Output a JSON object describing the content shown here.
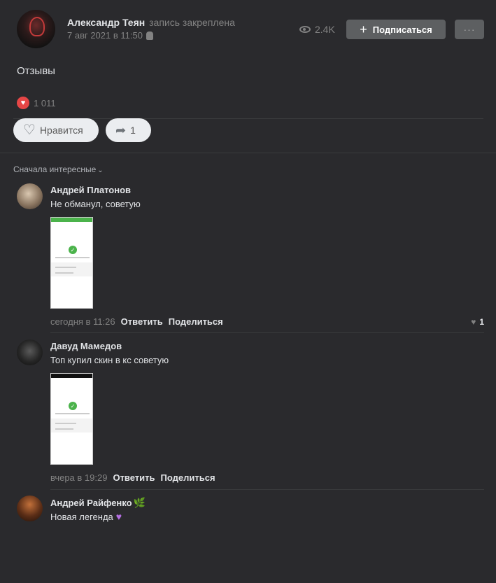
{
  "post": {
    "author": "Александр Теян",
    "pinned_label": "запись закреплена",
    "date": "7 авг 2021 в 11:50",
    "views": "2.4K",
    "subscribe_label": "Подписаться",
    "more_label": "···",
    "text": "Отзывы",
    "likes_count": "1 011",
    "like_label": "Нравится",
    "share_count": "1"
  },
  "comments_sort": {
    "label": "Сначала интересные"
  },
  "comments": [
    {
      "author": "Андрей Платонов",
      "text": "Не обманул, советую",
      "time": "сегодня в 11:26",
      "reply": "Ответить",
      "share": "Поделиться",
      "likes": "1"
    },
    {
      "author": "Давуд Мамедов",
      "text": "Топ купил скин в кс советую",
      "time": "вчера в 19:29",
      "reply": "Ответить",
      "share": "Поделиться"
    },
    {
      "author": "Андрей Райфенко",
      "text": "Новая легенда"
    }
  ],
  "colors": {
    "background": "#2a2a2d",
    "accent_red": "#e64646",
    "check_green": "#4bb34b"
  },
  "icons": {
    "views": "eye-icon",
    "device": "android-icon",
    "like": "heart-outline-icon",
    "share": "share-arrow-icon"
  }
}
